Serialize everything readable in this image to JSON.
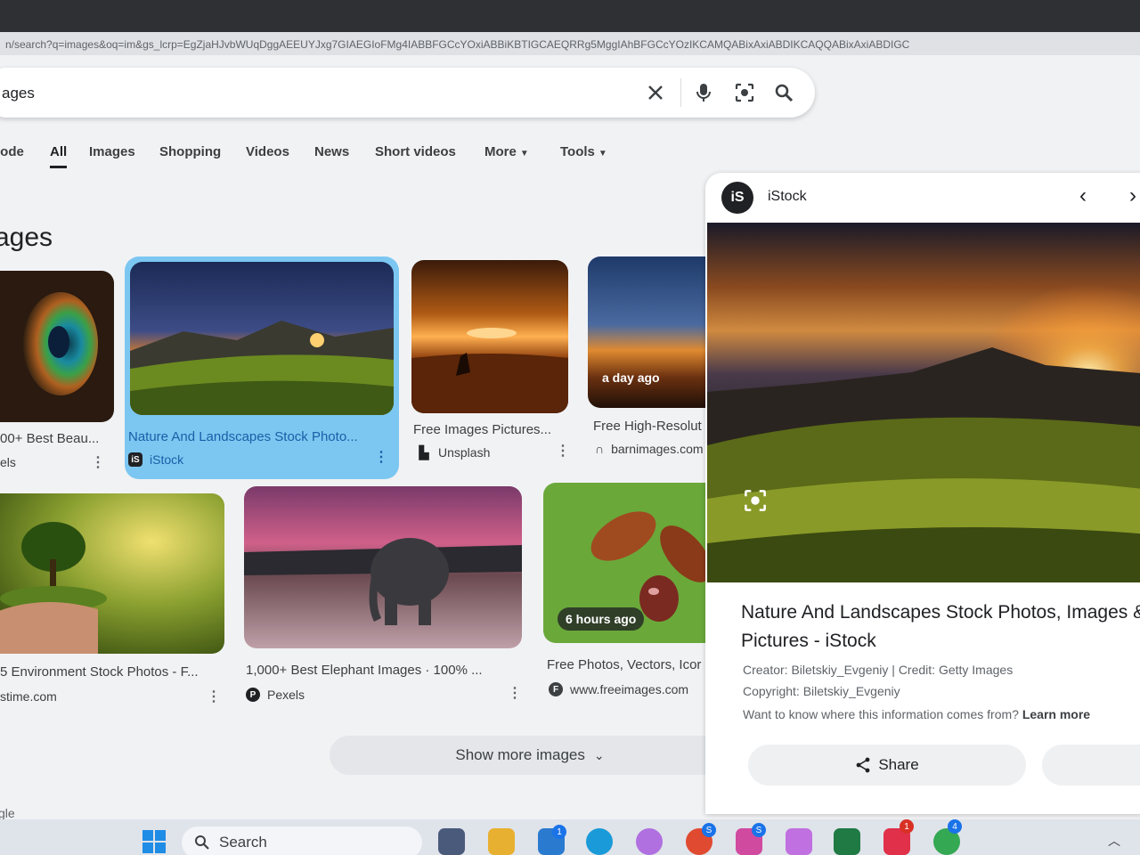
{
  "browser": {
    "url": "n/search?q=images&oq=im&gs_lcrp=EgZjaHJvbWUqDggAEEUYJxg7GIAEGIoFMg4IABBFGCcYOxiABBiKBTIGCAEQRRg5MggIAhBFGCcYOzIKCAMQABixAxiABDIKCAQQABixAxiABDIGC"
  },
  "search": {
    "query": "ages",
    "icons": [
      "close-icon",
      "mic-icon",
      "lens-icon",
      "search-icon"
    ]
  },
  "tabs": [
    {
      "label": "lode"
    },
    {
      "label": "All"
    },
    {
      "label": "Images"
    },
    {
      "label": "Shopping"
    },
    {
      "label": "Videos"
    },
    {
      "label": "News"
    },
    {
      "label": "Short videos"
    },
    {
      "label": "More"
    },
    {
      "label": "Tools"
    }
  ],
  "section_title": "ages",
  "results": [
    {
      "title": "00+ Best Beau...",
      "source": "els"
    },
    {
      "title": "Nature And Landscapes Stock Photo...",
      "source": "iStock",
      "selected": true
    },
    {
      "title": "Free Images Pictures...",
      "source": "Unsplash"
    },
    {
      "title": "Free High-Resolut",
      "source": "barnimages.com",
      "badge": "a day ago"
    },
    {
      "title": "5 Environment Stock Photos - F...",
      "source": "stime.com"
    },
    {
      "title": "1,000+ Best Elephant Images · 100% ...",
      "source": "Pexels"
    },
    {
      "title": "Free Photos, Vectors, Icor",
      "source": "www.freeimages.com",
      "badge": "6 hours ago"
    }
  ],
  "show_more": "Show more images",
  "panel": {
    "source_name": "iStock",
    "title": "Nature And Landscapes Stock Photos, Images & Pictures - iStock",
    "creator": "Creator: Biletskiy_Evgeniy | Credit: Getty Images",
    "copyright": "Copyright: Biletskiy_Evgeniy",
    "info_q": "Want to know where this information comes from?",
    "learn_more": "Learn more",
    "share": "Share"
  },
  "footer_text": "gle",
  "taskbar": {
    "search_label": "Search",
    "badges": [
      "1",
      "S",
      "S",
      "1",
      "4"
    ]
  },
  "colors": {
    "selected_card": "#7cc7f1",
    "selected_text": "#1a5fa8",
    "accent": "#1a73e8"
  }
}
